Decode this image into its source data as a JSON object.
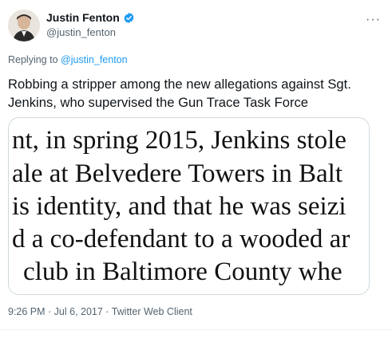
{
  "author": {
    "name": "Justin Fenton",
    "handle": "@justin_fenton"
  },
  "reply": {
    "prefix": "Replying to ",
    "to": "@justin_fenton"
  },
  "tweet": {
    "text": "Robbing a stripper among the new allegations against Sgt. Jenkins, who supervised the Gun Trace Task Force"
  },
  "media": {
    "lines": [
      "nt, in spring 2015, Jenkins stole",
      "ale at Belvedere Towers in Balt",
      "is identity, and that he was seizi",
      "d a co-defendant to a wooded ar",
      "club in Baltimore County whe"
    ]
  },
  "meta": {
    "text": "9:26 PM · Jul 6, 2017 · Twitter Web Client"
  },
  "colors": {
    "accent": "#1d9bf0",
    "secondary_text": "#536471",
    "primary_text": "#0f1419"
  },
  "icons": {
    "verified": "verified-badge-icon",
    "more": "more-icon"
  }
}
